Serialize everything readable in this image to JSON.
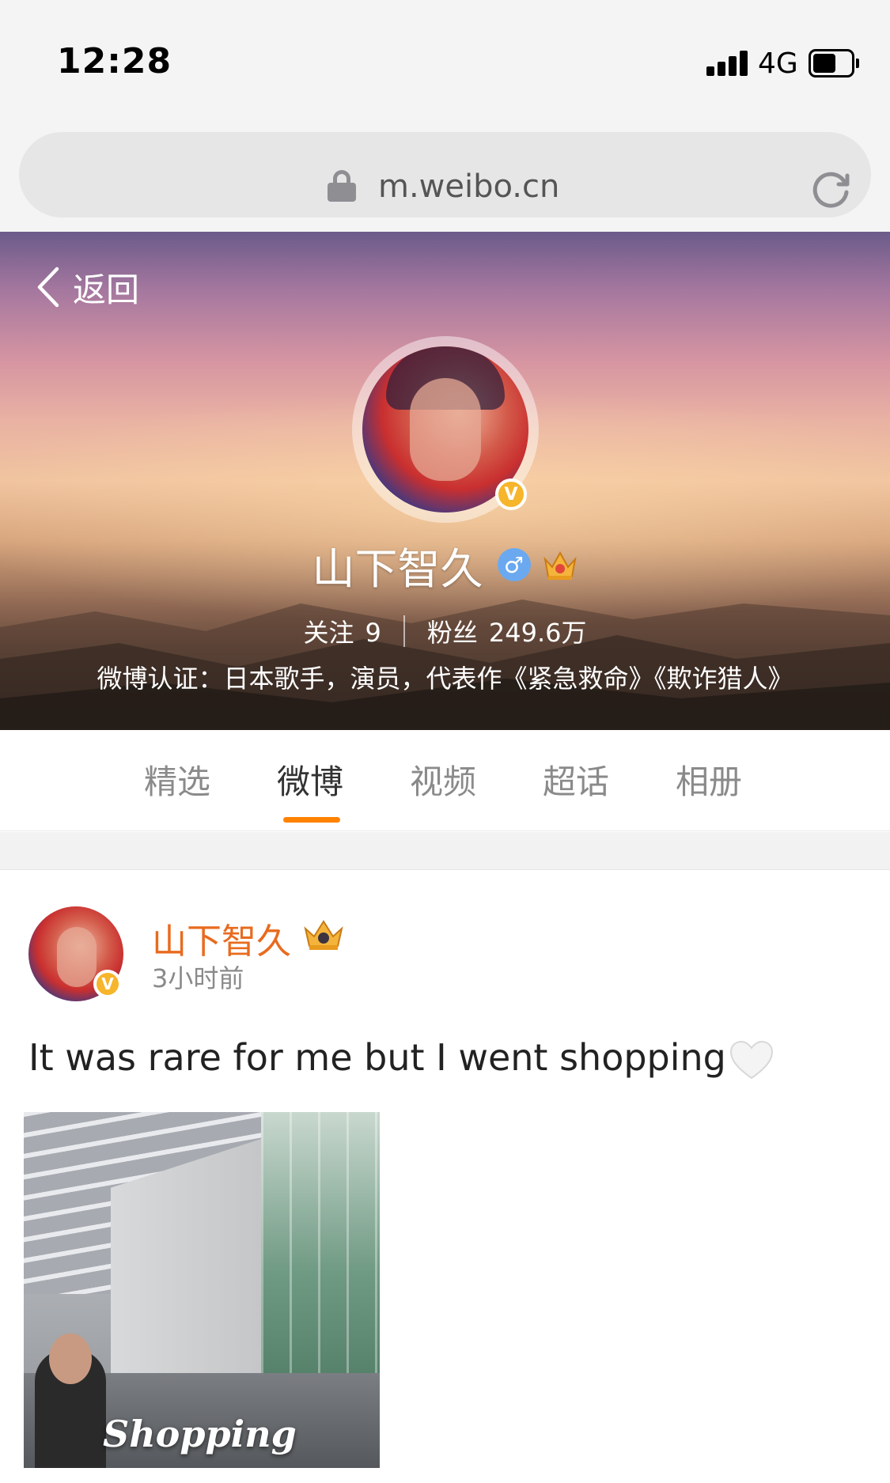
{
  "status_bar": {
    "time": "12:28",
    "network": "4G"
  },
  "browser": {
    "url": "m.weibo.cn"
  },
  "profile": {
    "back_label": "返回",
    "name": "山下智久",
    "gender_symbol": "♂",
    "following_label": "关注",
    "following_count": "9",
    "fans_label": "粉丝",
    "fans_count": "249.6万",
    "verification": "微博认证：日本歌手，演员，代表作《紧急救命》《欺诈猎人》",
    "verified_badge": "V"
  },
  "tabs": [
    {
      "label": "精选",
      "active": false
    },
    {
      "label": "微博",
      "active": true
    },
    {
      "label": "视频",
      "active": false
    },
    {
      "label": "超话",
      "active": false
    },
    {
      "label": "相册",
      "active": false
    }
  ],
  "post": {
    "author": "山下智久",
    "time": "3小时前",
    "text": "It was rare for me but I went shopping",
    "image_caption": "Shopping"
  },
  "colors": {
    "accent": "#ff8200",
    "author_name": "#e86b1f",
    "verified": "#f7b52c"
  }
}
